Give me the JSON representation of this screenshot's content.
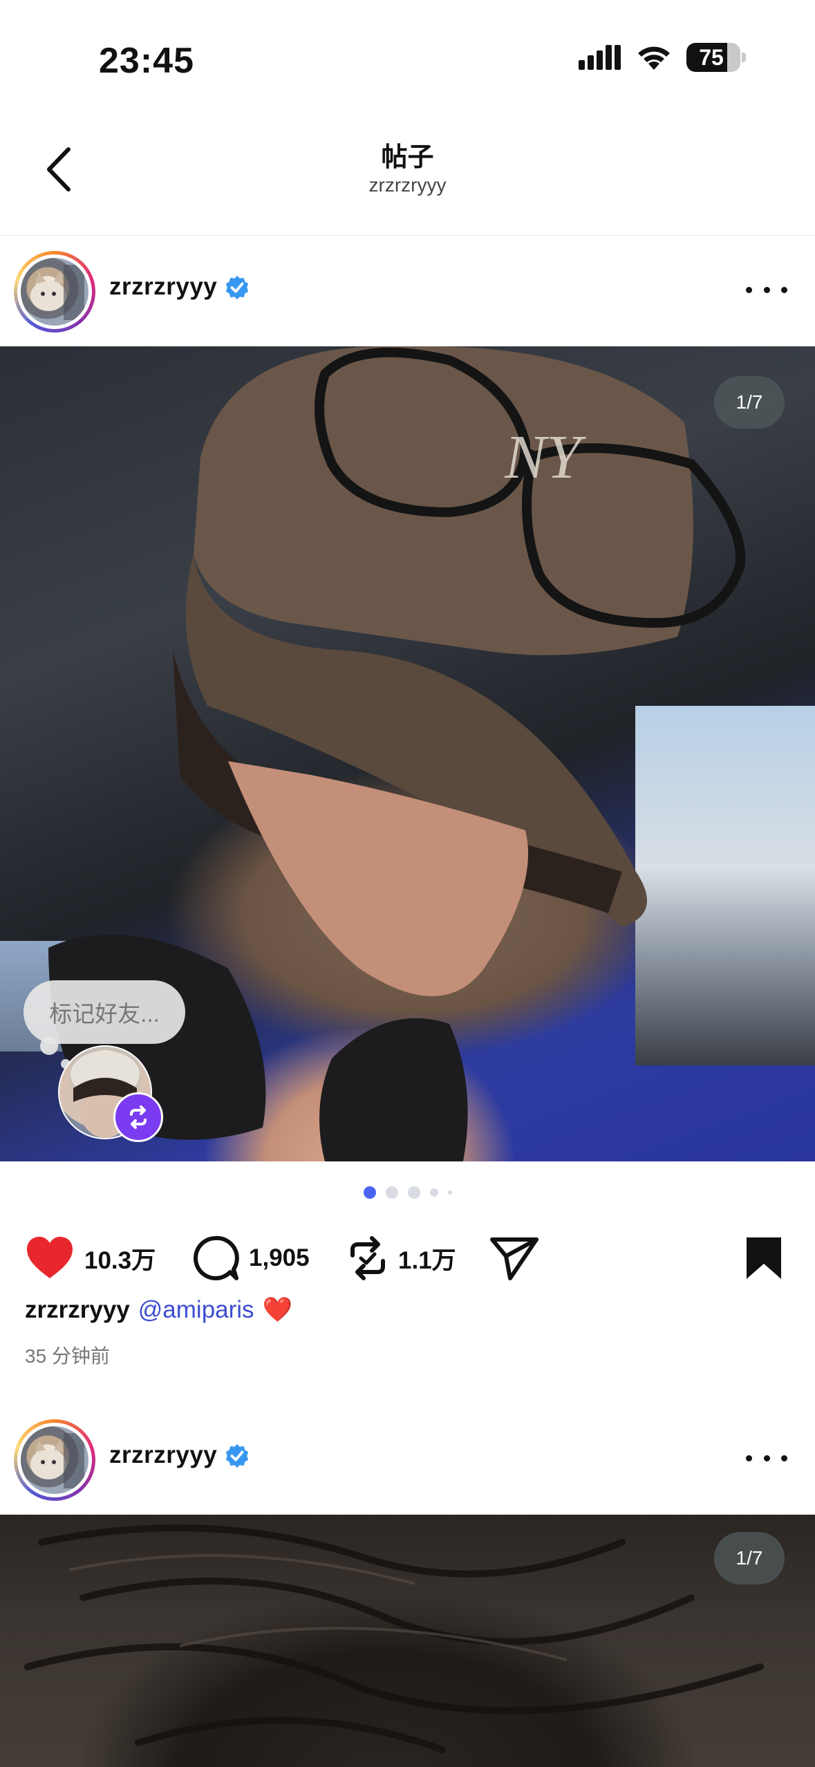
{
  "status_bar": {
    "time": "23:45",
    "battery_level": "75",
    "signal_icon": "cellular-signal-icon",
    "wifi_icon": "wifi-icon"
  },
  "nav": {
    "title": "帖子",
    "subtitle": "zrzrzryyy",
    "back_icon": "chevron-left-icon"
  },
  "posts": [
    {
      "username": "zrzrzryyy",
      "verified": true,
      "page_indicator": "1/7",
      "tag_prompt": "标记好友...",
      "carousel_total": 5,
      "carousel_active": 0,
      "likes": "10.3万",
      "comments": "1,905",
      "reposts": "1.1万",
      "liked": true,
      "bookmarked": true,
      "caption_user": "zrzrzryyy",
      "caption_mention": "@amiparis",
      "caption_emoji": "❤️",
      "time_ago": "35 分钟前"
    },
    {
      "username": "zrzrzryyy",
      "verified": true,
      "page_indicator": "1/7"
    }
  ],
  "colors": {
    "like_red": "#e8262d",
    "mention_blue": "#3d4dd1",
    "verified_blue": "#3897f0",
    "carousel_active": "#4a63f0",
    "collab_badge": "#7b3cf1"
  }
}
